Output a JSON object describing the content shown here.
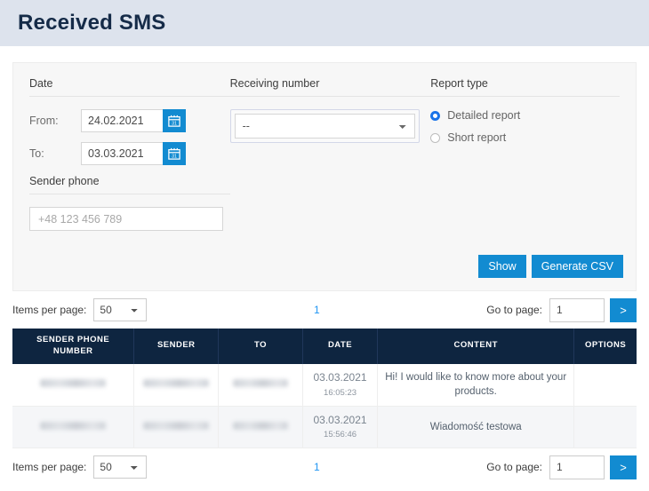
{
  "header": {
    "title": "Received SMS"
  },
  "filters": {
    "date": {
      "legend": "Date",
      "from_label": "From:",
      "from_value": "24.02.2021",
      "to_label": "To:",
      "to_value": "03.03.2021",
      "calendar_icon": "calendar-icon"
    },
    "sender_phone": {
      "legend": "Sender phone",
      "placeholder": "+48 123 456 789",
      "value": ""
    },
    "receiving_number": {
      "legend": "Receiving number",
      "selected": "--",
      "options": [
        "--"
      ]
    },
    "report_type": {
      "legend": "Report type",
      "options": [
        {
          "label": "Detailed report",
          "selected": true
        },
        {
          "label": "Short report",
          "selected": false
        }
      ]
    },
    "buttons": {
      "show": "Show",
      "generate_csv": "Generate CSV"
    }
  },
  "pagination": {
    "items_per_page_label": "Items per page:",
    "items_per_page_value": "50",
    "items_per_page_options": [
      "50"
    ],
    "current_page": "1",
    "goto_label": "Go to page:",
    "goto_value": "1",
    "goto_button": ">"
  },
  "table": {
    "columns": [
      "Sender phone number",
      "Sender",
      "To",
      "Date",
      "Content",
      "Options"
    ],
    "rows": [
      {
        "sender_phone_number": "",
        "sender": "",
        "to": "",
        "date": "03.03.2021",
        "time": "16:05:23",
        "content": "Hi! I would like to know more about your products.",
        "options": ""
      },
      {
        "sender_phone_number": "",
        "sender": "",
        "to": "",
        "date": "03.03.2021",
        "time": "15:56:46",
        "content": "Wiadomość testowa",
        "options": ""
      }
    ]
  },
  "colors": {
    "header_bg": "#dde3ed",
    "title": "#152b48",
    "accent_blue": "#128bd1",
    "link_blue": "#2196f3",
    "table_header_bg": "#0e2540",
    "radio_selected": "#1a73e8"
  }
}
